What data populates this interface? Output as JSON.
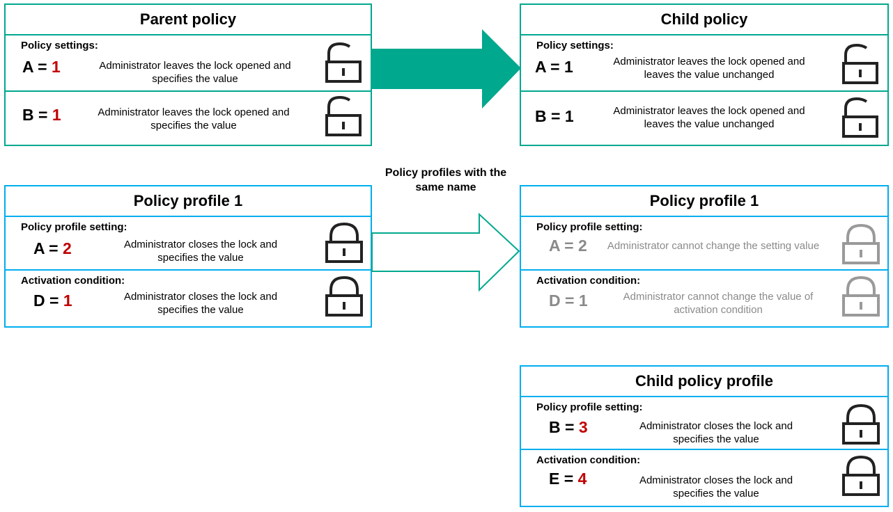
{
  "colors": {
    "policy_border": "#00a88e",
    "profile_border": "#00aeef",
    "value_red": "#c00000",
    "disabled_grey": "#8a8a8a"
  },
  "parent_policy": {
    "title": "Parent policy",
    "section_label": "Policy settings:",
    "rows": [
      {
        "name": "A",
        "value": "1",
        "description": "Administrator leaves the lock opened and specifies the value",
        "lock": "open"
      },
      {
        "name": "B",
        "value": "1",
        "description": "Administrator leaves the lock opened and specifies the value",
        "lock": "open"
      }
    ]
  },
  "child_policy": {
    "title": "Child policy",
    "section_label": "Policy settings:",
    "rows": [
      {
        "name": "A",
        "value": "1",
        "description": "Administrator leaves the lock opened and leaves the value unchanged",
        "lock": "open"
      },
      {
        "name": "B",
        "value": "1",
        "description": "Administrator leaves the lock opened and leaves the value unchanged",
        "lock": "open"
      }
    ]
  },
  "caption": "Policy profiles with the same name",
  "parent_profile": {
    "title": "Policy profile 1",
    "setting_label": "Policy profile setting:",
    "condition_label": "Activation condition:",
    "rows": [
      {
        "name": "A",
        "value": "2",
        "description": "Administrator closes the lock and specifies the value",
        "lock": "closed"
      },
      {
        "name": "D",
        "value": "1",
        "description": "Administrator closes the lock and specifies the value",
        "lock": "closed"
      }
    ]
  },
  "child_inherited_profile": {
    "title": "Policy profile 1",
    "setting_label": "Policy profile setting:",
    "condition_label": "Activation condition:",
    "rows": [
      {
        "name": "A",
        "value": "2",
        "description": "Administrator cannot change the setting value",
        "lock": "closed-disabled"
      },
      {
        "name": "D",
        "value": "1",
        "description": "Administrator cannot change the value of activation condition",
        "lock": "closed-disabled"
      }
    ]
  },
  "child_profile": {
    "title": "Child policy profile",
    "setting_label": "Policy profile setting:",
    "condition_label": "Activation condition:",
    "rows": [
      {
        "name": "B",
        "value": "3",
        "description": "Administrator closes the lock and specifies the value",
        "lock": "closed"
      },
      {
        "name": "E",
        "value": "4",
        "description": "Administrator closes the lock and specifies the value",
        "lock": "closed"
      }
    ]
  }
}
